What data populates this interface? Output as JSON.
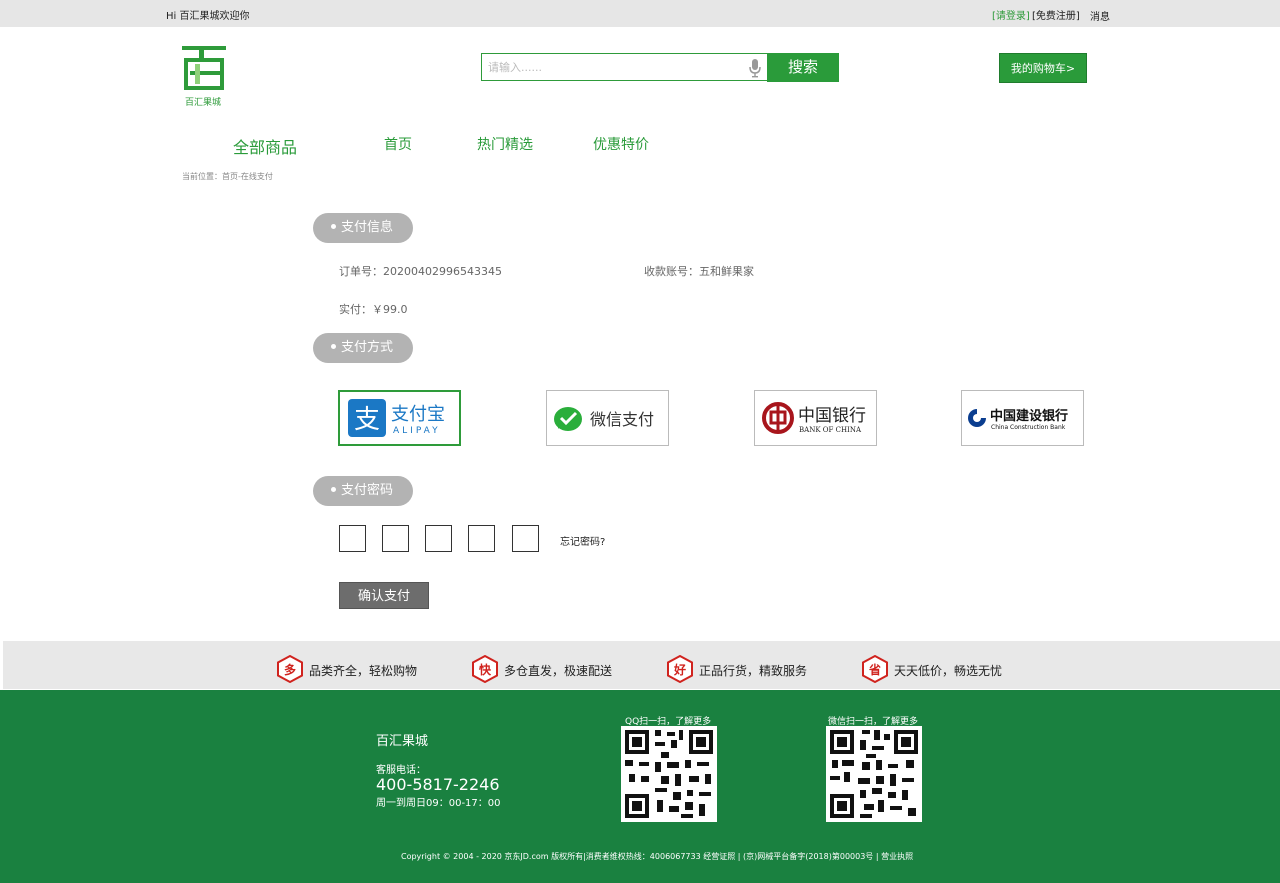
{
  "topbar": {
    "greeting": "Hi 百汇果城欢迎你",
    "login": "[请登录]",
    "register": "[免费注册]",
    "messages": "消息"
  },
  "logo": {
    "text": "百汇果城"
  },
  "search": {
    "placeholder": "请输入......",
    "button": "搜索"
  },
  "cart": {
    "label": "我的购物车>"
  },
  "nav": {
    "all": "全部商品",
    "items": [
      "首页",
      "热门精选",
      "优惠特价"
    ]
  },
  "breadcrumb": "当前位置：首页-在线支付",
  "sections": {
    "info_title": "支付信息",
    "method_title": "支付方式",
    "password_title": "支付密码"
  },
  "order": {
    "order_no": "订单号：20200402996543345",
    "payee": "收款账号：五和鲜果家",
    "paid": "实付：￥99.0"
  },
  "payment_methods": [
    {
      "name": "支付宝",
      "sub": "ALIPAY",
      "icon": "alipay-icon",
      "color": "#1b78c5",
      "selected": true
    },
    {
      "name": "微信支付",
      "icon": "wechat-pay-icon",
      "color": "#2aae3b",
      "selected": false
    },
    {
      "name": "中国银行",
      "sub": "BANK OF CHINA",
      "icon": "bank-of-china-icon",
      "color": "#a8151c",
      "selected": false
    },
    {
      "name": "中国建设银行",
      "sub": "China Construction Bank",
      "icon": "ccb-icon",
      "color": "#0a3d8f",
      "selected": false
    }
  ],
  "password": {
    "forgot": "忘记密码?"
  },
  "confirm": "确认支付",
  "features": [
    {
      "badge": "多",
      "text": "品类齐全，轻松购物"
    },
    {
      "badge": "快",
      "text": "多仓直发，极速配送"
    },
    {
      "badge": "好",
      "text": "正品行货，精致服务"
    },
    {
      "badge": "省",
      "text": "天天低价，畅选无忧"
    }
  ],
  "footer": {
    "brand": "百汇果城",
    "service_label": "客服电话：",
    "phone": "400-5817-2246",
    "hours": "周一到周日09：00-17：00",
    "qq_caption": "QQ扫一扫，了解更多",
    "wechat_caption": "微信扫一扫，了解更多",
    "copyright": "Copyright © 2004 - 2020 京东JD.com 版权所有|消费者维权热线：4006067733 经营证照 | (京)网械平台备字(2018)第00003号 | 营业执照"
  },
  "colors": {
    "brand_green": "#2a9b3a",
    "footer_green": "#1a8140",
    "pill_gray": "#b3b3b3",
    "badge_red": "#d0231e"
  }
}
